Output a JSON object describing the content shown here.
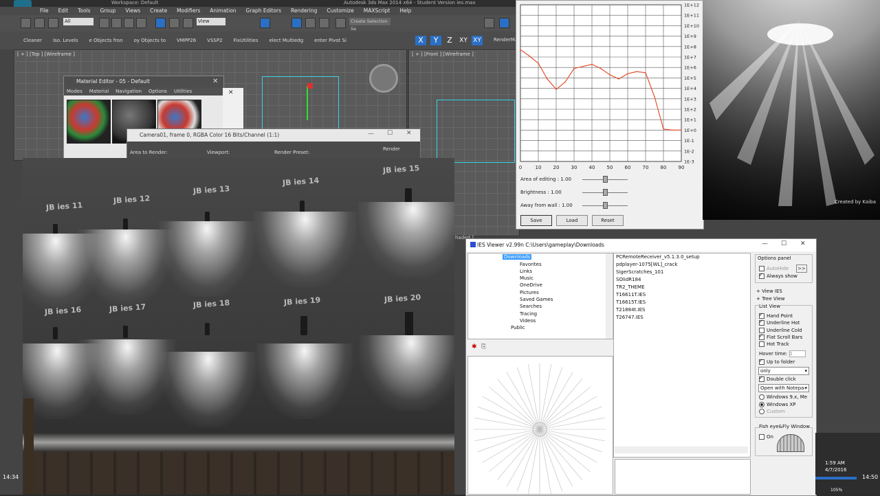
{
  "max": {
    "title": "Autodesk 3ds Max 2014 x64 - Student Version  ies.max",
    "workspace": "Workspace: Default",
    "menus": [
      "File",
      "Edit",
      "Tools",
      "Group",
      "Views",
      "Create",
      "Modifiers",
      "Animation",
      "Graph Editors",
      "Rendering",
      "Customize",
      "MAXScript",
      "Help"
    ],
    "toolbar1": {
      "filter": "All",
      "view": "View",
      "selection_set": "Create Selection Se"
    },
    "toolbar2": [
      "Cleaner",
      "Iso. Levels",
      "e Objects fron",
      "oy Objects to",
      "VMPP26",
      "VSSP2",
      "FixUtilities",
      "elect Multiedg",
      "enter Pivot Si"
    ],
    "axis": [
      "X",
      "Y",
      "Z",
      "XY",
      "XY"
    ],
    "render_menu": "RenderMa",
    "viewports": {
      "top": "[ + ] [Top ] [Wireframe ]",
      "front": "[ + ] [Front ] [Wireframe ]"
    },
    "shaded_label": "haded ]",
    "time_left": "14:34",
    "time_right": "14:50"
  },
  "material_editor": {
    "title": "Material Editor - 05 - Default",
    "menus": [
      "Modes",
      "Material",
      "Navigation",
      "Options",
      "Utilities"
    ]
  },
  "camera_frame": {
    "title": "Camera01, frame 0, RGBA Color 16 Bits/Channel (1:1)",
    "area_label": "Area to Render:",
    "viewport_label": "Viewport:",
    "preset_label": "Render Preset:",
    "render_button": "Render"
  },
  "render": {
    "labels": [
      "JB ies 11",
      "JB ies 12",
      "JB ies 13",
      "JB ies 14",
      "JB ies 15",
      "JB ies 16",
      "JB ies 17",
      "JB ies 18",
      "JB ies 19",
      "JB ies 20"
    ]
  },
  "chart_data": {
    "type": "line",
    "title": "",
    "xlabel": "",
    "ylabel": "",
    "x_ticks": [
      0,
      10,
      20,
      30,
      40,
      50,
      60,
      70,
      80,
      90
    ],
    "y_ticks": [
      "1E+12",
      "1E+11",
      "1E+10",
      "1E+9",
      "1E+8",
      "1E+7",
      "1E+6",
      "1E+5",
      "1E+4",
      "1E+3",
      "1E+2",
      "1E+1",
      "1E+0",
      "1E-1",
      "1E-2",
      "1E-3"
    ],
    "xlim": [
      0,
      90
    ],
    "ylim_log10": [
      -3,
      12
    ],
    "grid": true,
    "series": [
      {
        "color": "#e05030",
        "x": [
          0,
          5,
          10,
          15,
          20,
          25,
          30,
          35,
          40,
          45,
          50,
          55,
          60,
          65,
          70,
          75,
          80,
          85,
          90
        ],
        "log10_y": [
          7.7,
          7.1,
          6.4,
          4.9,
          3.9,
          4.6,
          5.9,
          6.1,
          6.3,
          5.9,
          5.3,
          4.9,
          5.4,
          5.6,
          5.5,
          3.2,
          0.1,
          0.0,
          0.0
        ]
      }
    ]
  },
  "chart_controls": {
    "sliders": [
      {
        "label": "Area of editing :",
        "value": "1.00"
      },
      {
        "label": "Brightness :",
        "value": "1.00"
      },
      {
        "label": "Away from wall :",
        "value": "1.00"
      }
    ],
    "buttons": [
      "Save",
      "Load",
      "Reset"
    ]
  },
  "preview": {
    "credit": "Created by Kaiba"
  },
  "ies_viewer": {
    "title": "IES Viewer v2.99n   C:\\Users\\gameplay\\Downloads",
    "tree": [
      "Downloads",
      "Favorites",
      "Links",
      "Music",
      "OneDrive",
      "Pictures",
      "Saved Games",
      "Searches",
      "Tracing",
      "Videos",
      "Public"
    ],
    "files": [
      "PCRemoteReceiver_v5.1.3.0_setup",
      "pdplayer-1075[WL]_crack",
      "SigerScratches_101",
      "SOlidR184",
      "TR2_THEME",
      "T16611T.IES",
      "T16615T.IES",
      "T21884t.IES",
      "T26747.IES"
    ],
    "options_panel": "Options panel",
    "auto_hide": "AutoHide",
    "always_show": "Always show",
    "view_ies": "+ View IES",
    "tree_view": "+ Tree View",
    "list_view": "List View",
    "list_opts": [
      {
        "label": "Hand Point",
        "on": true
      },
      {
        "label": "Underline Hot",
        "on": true
      },
      {
        "label": "Underline Cold",
        "on": false
      },
      {
        "label": "Flat Scroll Bars",
        "on": true
      },
      {
        "label": "Hot Track",
        "on": false
      }
    ],
    "hover_label": "Hover time:",
    "hover_value": "1",
    "up_to_folder": "Up to folder",
    "only_select": "only",
    "double_click": "Double click",
    "open_with": "Open with Notepad",
    "radio": [
      "Windows 9.x, Me",
      "Windows XP",
      "Custom"
    ],
    "fisheye": "Fish eye&Fly Window",
    "on": "On",
    "clock_time": "1:59 AM",
    "clock_date": "4/7/2016",
    "zoom": "105%"
  }
}
